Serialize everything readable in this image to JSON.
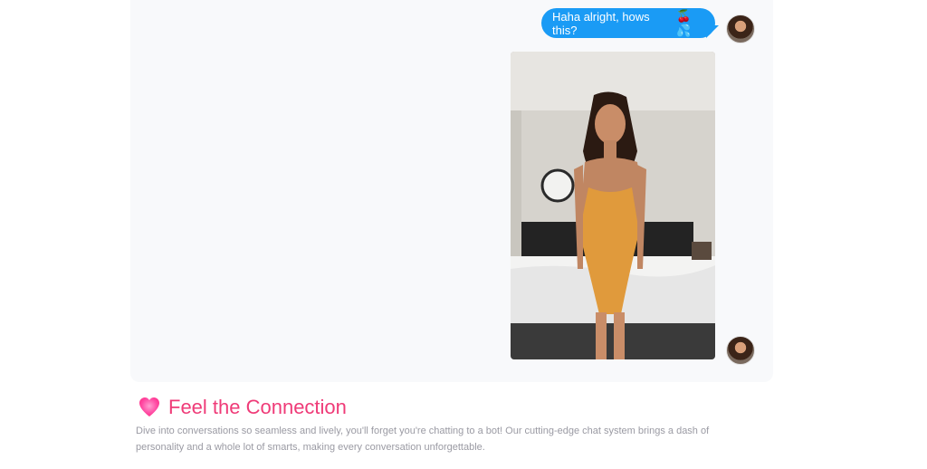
{
  "chat": {
    "message_text": "Haha alright, hows this?",
    "message_emojis": "🍒💦",
    "bubble_color": "#1a9bf5",
    "image_alt": "Photo of woman in orange swimsuit in bedroom"
  },
  "feature": {
    "icon": "pink-heart-icon",
    "title": "Feel the Connection",
    "description": "Dive into conversations so seamless and lively, you'll forget you're chatting to a bot! Our cutting-edge chat system brings a dash of personality and a whole lot of smarts, making every conversation unforgettable.",
    "title_color": "#ef3b78"
  }
}
